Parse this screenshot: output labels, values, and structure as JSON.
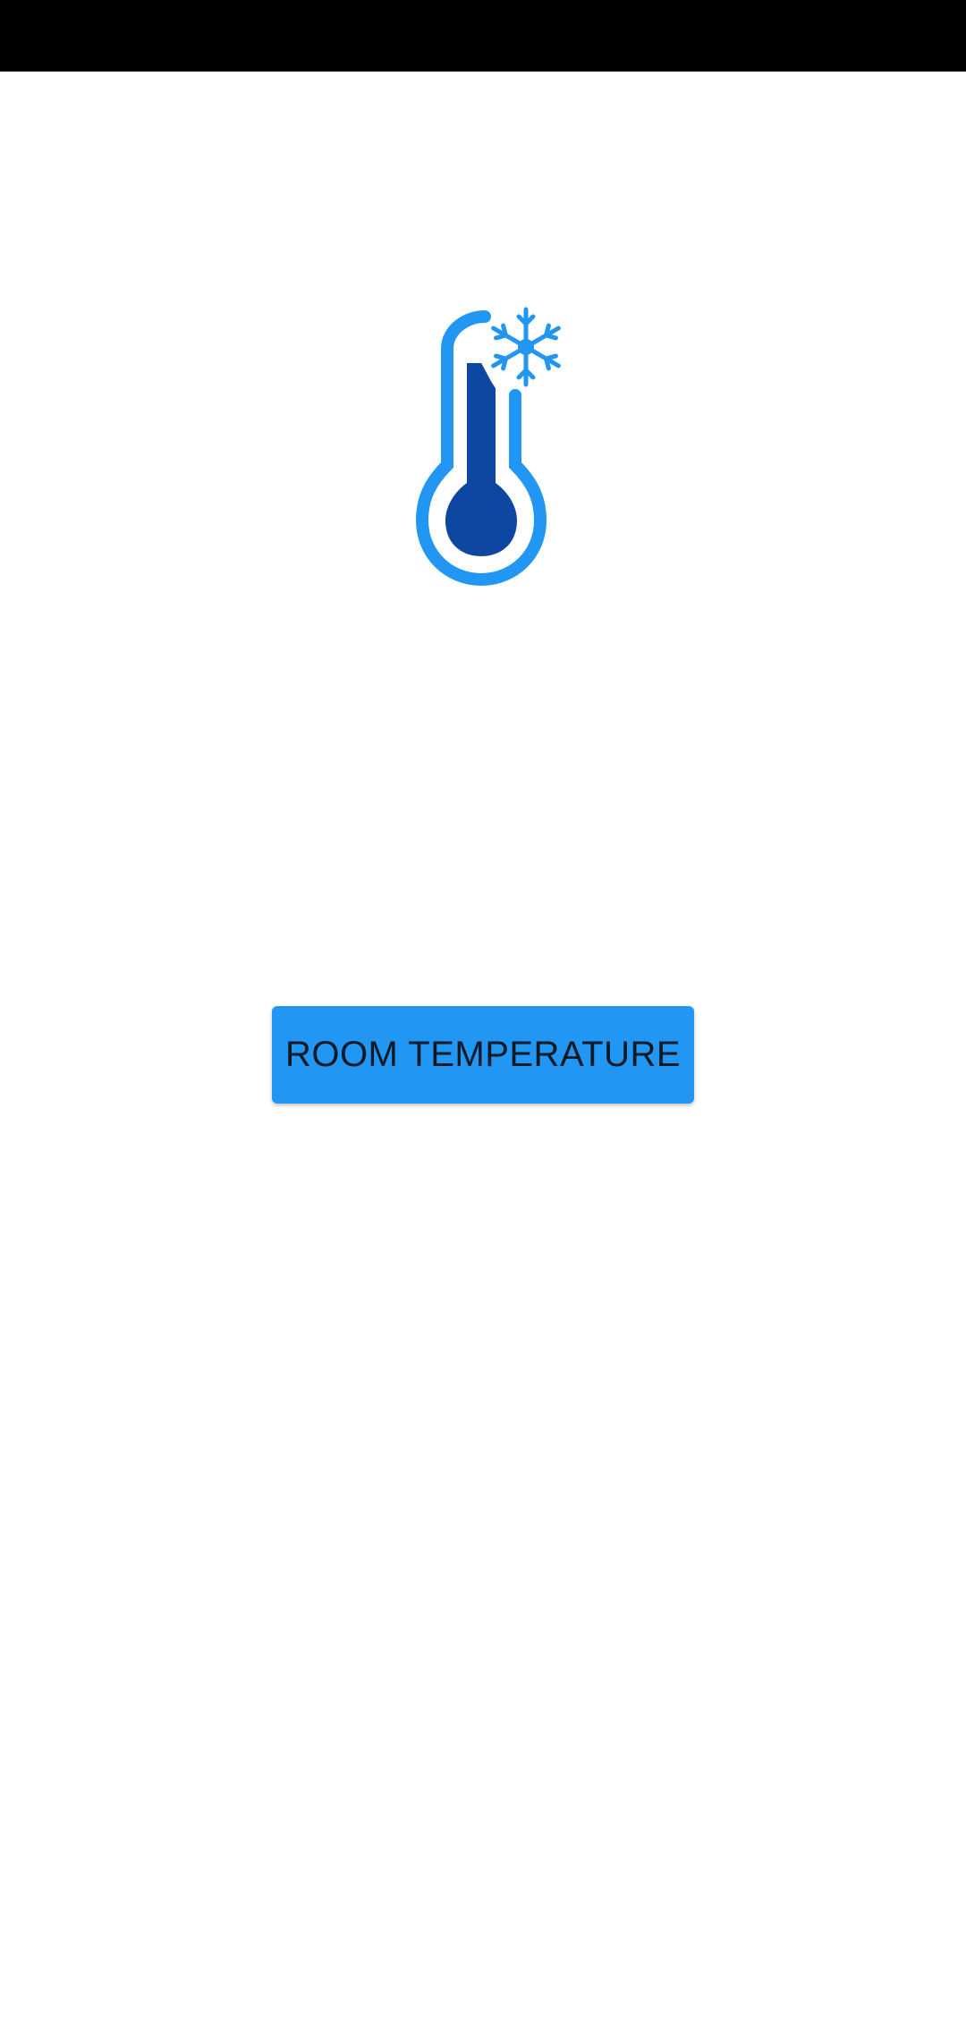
{
  "status_bar": {
    "color": "#000000"
  },
  "logo": {
    "icon": "thermometer-snowflake-icon",
    "outline_color": "#2196f3",
    "fill_color": "#0d47a1"
  },
  "main": {
    "button_label": "ROOM TEMPERATURE",
    "button_color": "#2196f3"
  }
}
